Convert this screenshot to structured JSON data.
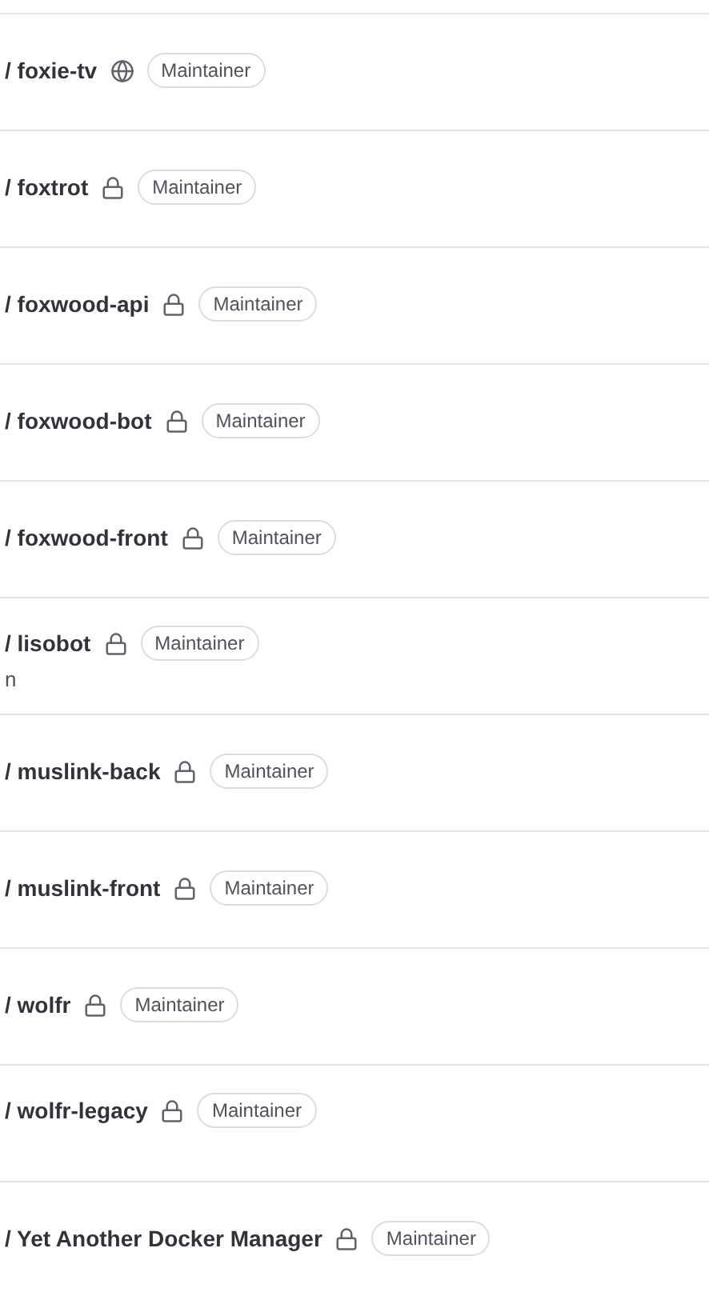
{
  "projects": [
    {
      "name": "/ foxie-tv",
      "kind": "public",
      "role": "Maintainer",
      "described": false
    },
    {
      "name": "/ foxtrot",
      "kind": "private",
      "role": "Maintainer",
      "described": false
    },
    {
      "name": "/ foxwood-api",
      "kind": "private",
      "role": "Maintainer",
      "described": false
    },
    {
      "name": "/ foxwood-bot",
      "kind": "private",
      "role": "Maintainer",
      "described": false
    },
    {
      "name": "/ foxwood-front",
      "kind": "private",
      "role": "Maintainer",
      "described": false
    },
    {
      "name": "/ lisobot",
      "kind": "private",
      "role": "Maintainer",
      "described": true,
      "description": "n"
    },
    {
      "name": "/ muslink-back",
      "kind": "private",
      "role": "Maintainer",
      "described": false
    },
    {
      "name": "/ muslink-front",
      "kind": "private",
      "role": "Maintainer",
      "described": false
    },
    {
      "name": "/ wolfr",
      "kind": "private",
      "role": "Maintainer",
      "described": false
    },
    {
      "name": "/ wolfr-legacy",
      "kind": "private",
      "role": "Maintainer",
      "described": true
    },
    {
      "name": "/ Yet Another Docker Manager",
      "kind": "private",
      "role": "Maintainer",
      "described": false
    }
  ]
}
